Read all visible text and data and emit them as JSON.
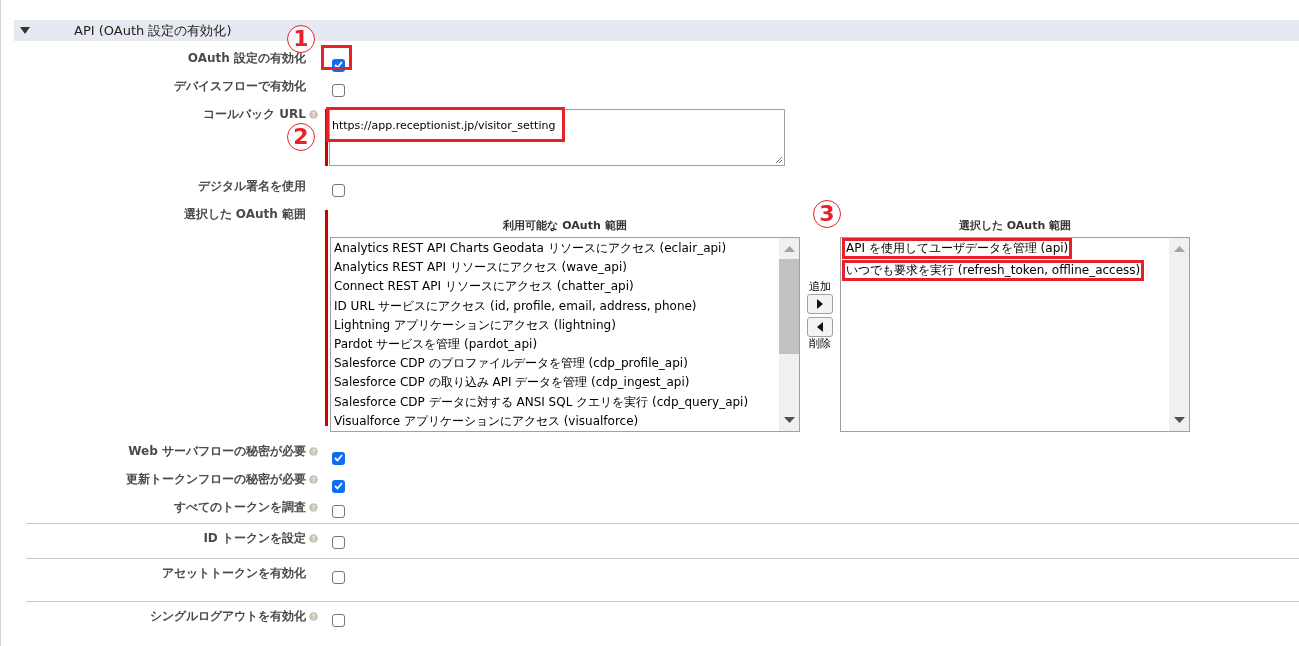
{
  "section": {
    "title": "API (OAuth 設定の有効化)",
    "expanded": true
  },
  "fields": [
    {
      "kind": "checkbox",
      "label": "OAuth 設定の有効化",
      "help": false,
      "checked": true,
      "highlighted": true,
      "callout": "1"
    },
    {
      "kind": "checkbox",
      "label": "デバイスフローで有効化",
      "help": false,
      "checked": false
    },
    {
      "kind": "textarea",
      "label": "コールバック URL",
      "help": true,
      "required": true,
      "value": "https://app.receptionist.jp/visitor_setting",
      "highlighted": true,
      "callout": "2"
    },
    {
      "kind": "checkbox",
      "label": "デジタル署名を使用",
      "help": false,
      "checked": false
    },
    {
      "kind": "dual_list",
      "label": "選択した OAuth 範囲",
      "help": false,
      "required": true,
      "callout": "3",
      "available_title": "利用可能な OAuth 範囲",
      "selected_title": "選択した OAuth 範囲",
      "add_label": "追加",
      "remove_label": "削除",
      "available_items": [
        {
          "text": "Analytics REST API Charts Geodata リソースにアクセス (eclair_api)"
        },
        {
          "text": "Analytics REST API リソースにアクセス (wave_api)"
        },
        {
          "text": "Connect REST API リソースにアクセス (chatter_api)"
        },
        {
          "text": "ID URL サービスにアクセス (id, profile, email, address, phone)"
        },
        {
          "text": "Lightning アプリケーションにアクセス (lightning)"
        },
        {
          "text": "Pardot サービスを管理 (pardot_api)"
        },
        {
          "text": "Salesforce CDP のプロファイルデータを管理 (cdp_profile_api)"
        },
        {
          "text": "Salesforce CDP の取り込み API データを管理 (cdp_ingest_api)"
        },
        {
          "text": "Salesforce CDP データに対する ANSI SQL クエリを実行 (cdp_query_api)"
        },
        {
          "text": "Visualforce アプリケーションにアクセス (visualforce)"
        }
      ],
      "selected_items": [
        {
          "text": "API を使用してユーザデータを管理 (api)",
          "highlighted": true
        },
        {
          "text": "いつでも要求を実行 (refresh_token, offline_access)",
          "highlighted": true
        }
      ]
    },
    {
      "kind": "checkbox",
      "label": "Web サーバフローの秘密が必要",
      "help": true,
      "checked": true
    },
    {
      "kind": "checkbox",
      "label": "更新トークンフローの秘密が必要",
      "help": true,
      "checked": true
    },
    {
      "kind": "checkbox",
      "label": "すべてのトークンを調査",
      "help": true,
      "checked": false
    },
    {
      "kind": "checkbox",
      "label": "ID トークンを設定",
      "help": true,
      "checked": false,
      "divider_above": true
    },
    {
      "kind": "checkbox",
      "label": "アセットトークンを有効化",
      "help": false,
      "checked": false,
      "divider_above": true,
      "tall": true
    },
    {
      "kind": "checkbox",
      "label": "シングルログアウトを有効化",
      "help": true,
      "checked": false,
      "divider_above": true
    }
  ]
}
